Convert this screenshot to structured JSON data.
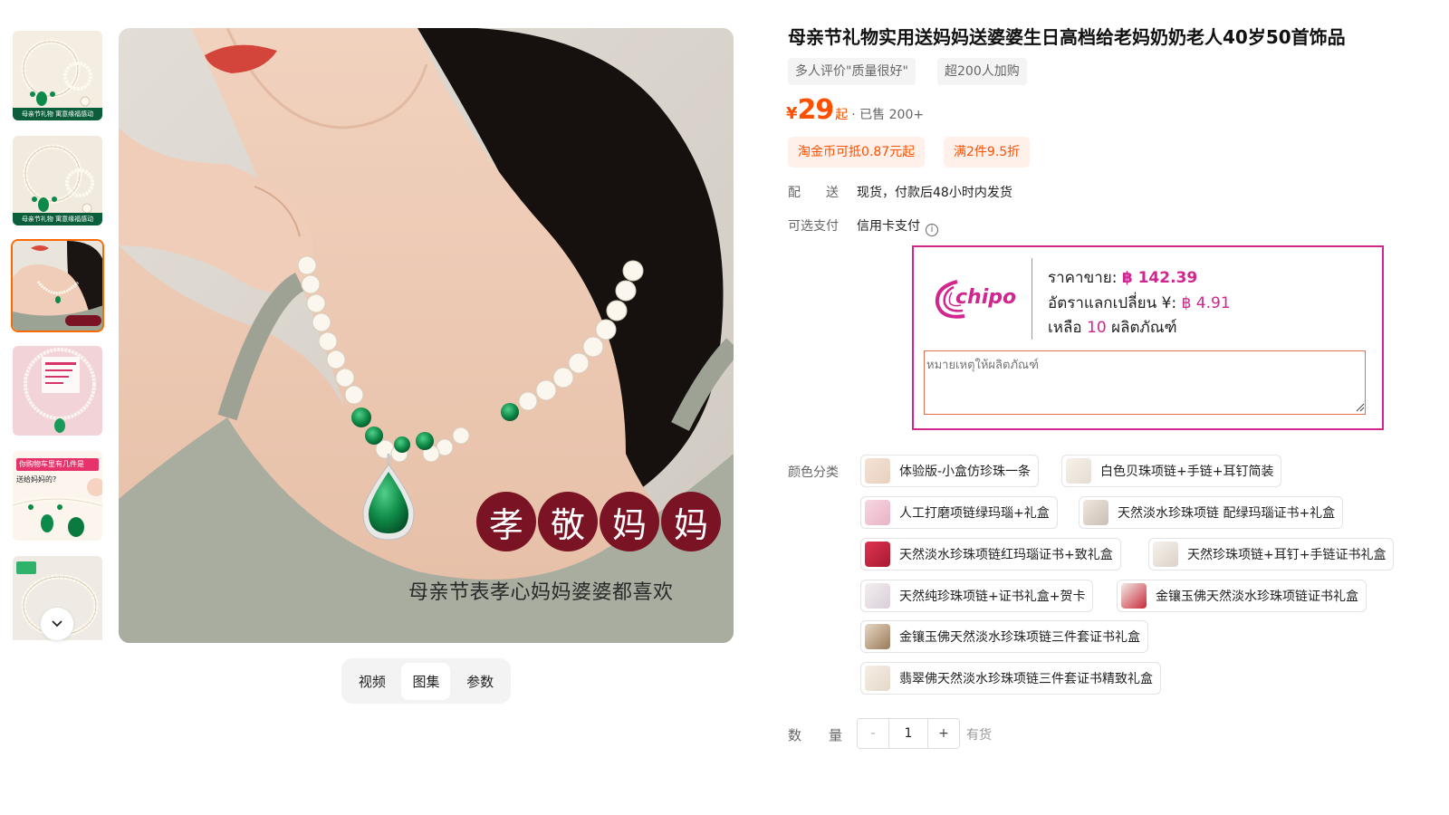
{
  "product": {
    "title": "母亲节礼物实用送妈妈送婆婆生日高档给老妈奶奶老人40岁50首饰品",
    "tags": [
      "多人评价\"质量很好\"",
      "超200人加购"
    ],
    "price": {
      "symbol": "¥",
      "amount": "29",
      "suffix": "起",
      "sold": "· 已售 200+"
    },
    "promos": [
      "淘金币可抵0.87元起",
      "满2件9.5折"
    ],
    "shipping": {
      "label": "配　　送",
      "value": "现货，付款后48小时内发货"
    },
    "payment": {
      "label": "可选支付",
      "value": "信用卡支付",
      "icon": "info-icon"
    }
  },
  "gallery": {
    "thumbnails": [
      {
        "caption": "母亲节礼物 寓意缘福感动",
        "style": "pearl-set"
      },
      {
        "caption": "母亲节礼物 寓意缘福感动",
        "style": "pearl-set"
      },
      {
        "caption": "",
        "style": "model",
        "active": true
      },
      {
        "caption": "",
        "style": "pink-card"
      },
      {
        "caption": "你购物车里有几件是",
        "subcaption": "送给妈妈的?",
        "style": "pink-promo"
      },
      {
        "caption": "",
        "style": "pearl-flat"
      }
    ],
    "scroll_icon": "chevron-down-icon",
    "main_image": {
      "overlay_chars": [
        "孝",
        "敬",
        "妈",
        "妈"
      ],
      "caption": "母亲节表孝心妈妈婆婆都喜欢"
    },
    "media_tabs": [
      {
        "label": "视频",
        "active": false
      },
      {
        "label": "图集",
        "active": true
      },
      {
        "label": "参数",
        "active": false
      }
    ]
  },
  "chipo": {
    "logo_text": "chipo",
    "price_label": "ราคาขาย:",
    "price_value": "฿ 142.39",
    "rate_label": "อัตราแลกเปลี่ยน ¥:",
    "rate_value": "฿ 4.91",
    "remain_prefix": "เหลือ",
    "remain_count": "10",
    "remain_suffix": "ผลิตภัณฑ์",
    "note_placeholder": "หมายเหตุให้ผลิตภัณฑ์",
    "accent": "#d0268e"
  },
  "sku": {
    "label": "颜色分类",
    "options": [
      "体验版-小盒仿珍珠一条",
      "白色贝珠项链+手链+耳钉简装",
      "人工打磨项链绿玛瑙+礼盒",
      "天然淡水珍珠项链 配绿玛瑙证书+礼盒",
      "天然淡水珍珠项链红玛瑙证书+致礼盒",
      "天然珍珠项链+耳钉+手链证书礼盒",
      "天然纯珍珠项链+证书礼盒+贺卡",
      "金镶玉佛天然淡水珍珠项链证书礼盒",
      "金镶玉佛天然淡水珍珠项链三件套证书礼盒",
      "翡翠佛天然淡水珍珠项链三件套证书精致礼盒"
    ]
  },
  "quantity": {
    "label": "数　　量",
    "minus": "-",
    "value": "1",
    "plus": "+",
    "stock": "有货"
  }
}
